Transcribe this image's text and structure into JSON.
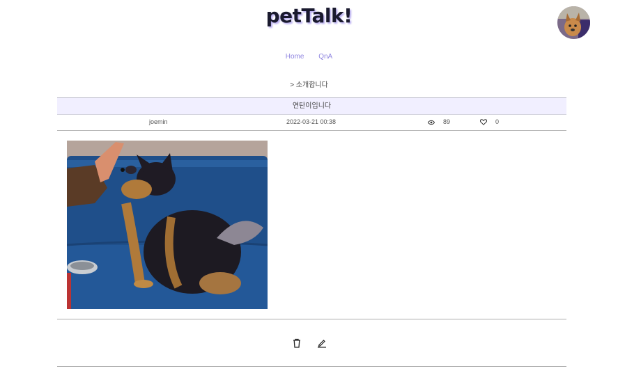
{
  "header": {
    "logo": "petTalk!"
  },
  "nav": {
    "items": [
      "Home",
      "QnA"
    ]
  },
  "breadcrumb": "> 소개합니다",
  "post": {
    "title": "연탄이입니다",
    "author": "joemin",
    "date": "2022-03-21 00:38",
    "views": "89",
    "likes": "0"
  },
  "icons": {
    "views": "eye-icon",
    "likes": "heart-icon",
    "delete": "trash-icon",
    "edit": "pencil-icon"
  },
  "colors": {
    "accent": "#8f85e0",
    "title_bar_bg": "#f1efff",
    "sofa": "#1f4f8a"
  }
}
